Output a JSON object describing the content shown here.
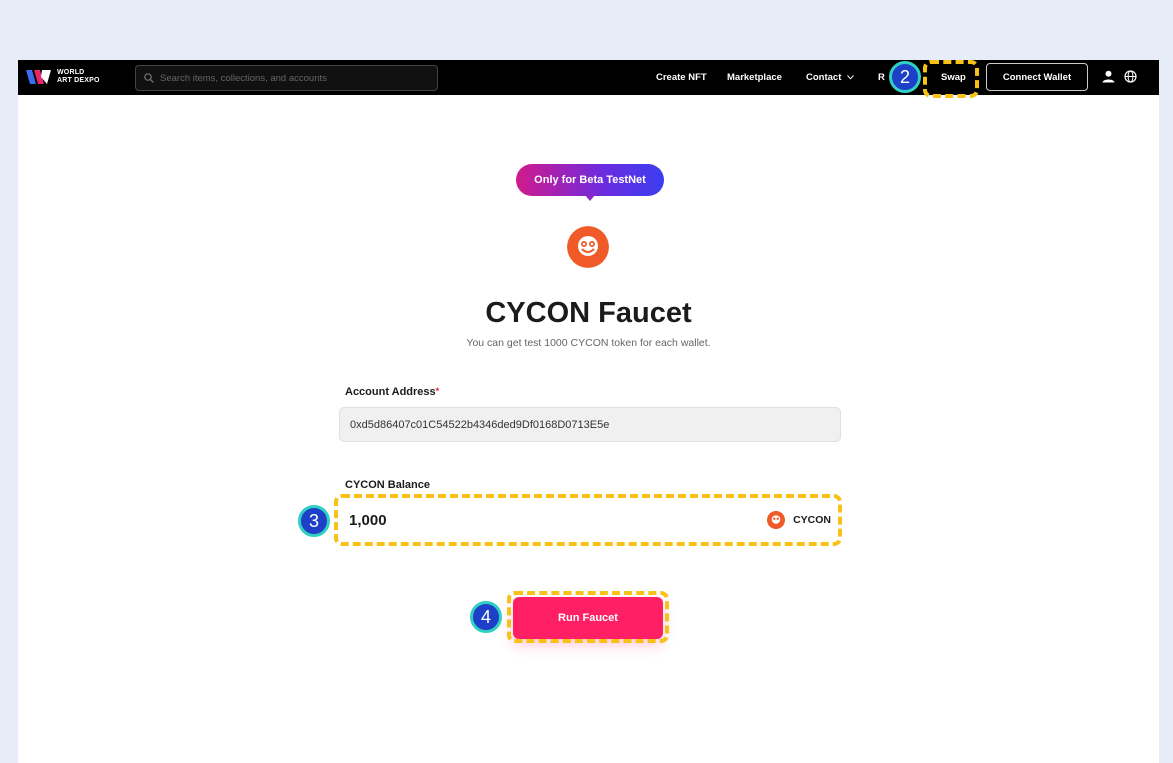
{
  "navbar": {
    "logo_line1": "WORLD",
    "logo_line2": "ART DEXPO",
    "search_placeholder": "Search items, collections, and accounts",
    "links": {
      "create_nft": "Create NFT",
      "marketplace": "Marketplace",
      "contact": "Contact",
      "partial": "R",
      "swap": "Swap"
    },
    "connect_wallet": "Connect Wallet"
  },
  "steps": {
    "s2": "2",
    "s3": "3",
    "s4": "4"
  },
  "main": {
    "badge": "Only for Beta TestNet",
    "title": "CYCON Faucet",
    "subtitle": "You can get test 1000 CYCON token for each wallet.",
    "account_label": "Account Address",
    "required_mark": "*",
    "account_value": "0xd5d86407c01C54522b4346ded9Df0168D0713E5e",
    "balance_label": "CYCON Balance",
    "balance_value": "1,000",
    "balance_unit": "CYCON",
    "run_button": "Run Faucet"
  },
  "colors": {
    "accent": "#ff1f65",
    "highlight": "#f7c215",
    "step_badge": "#1e40c8",
    "token": "#f05a28"
  }
}
